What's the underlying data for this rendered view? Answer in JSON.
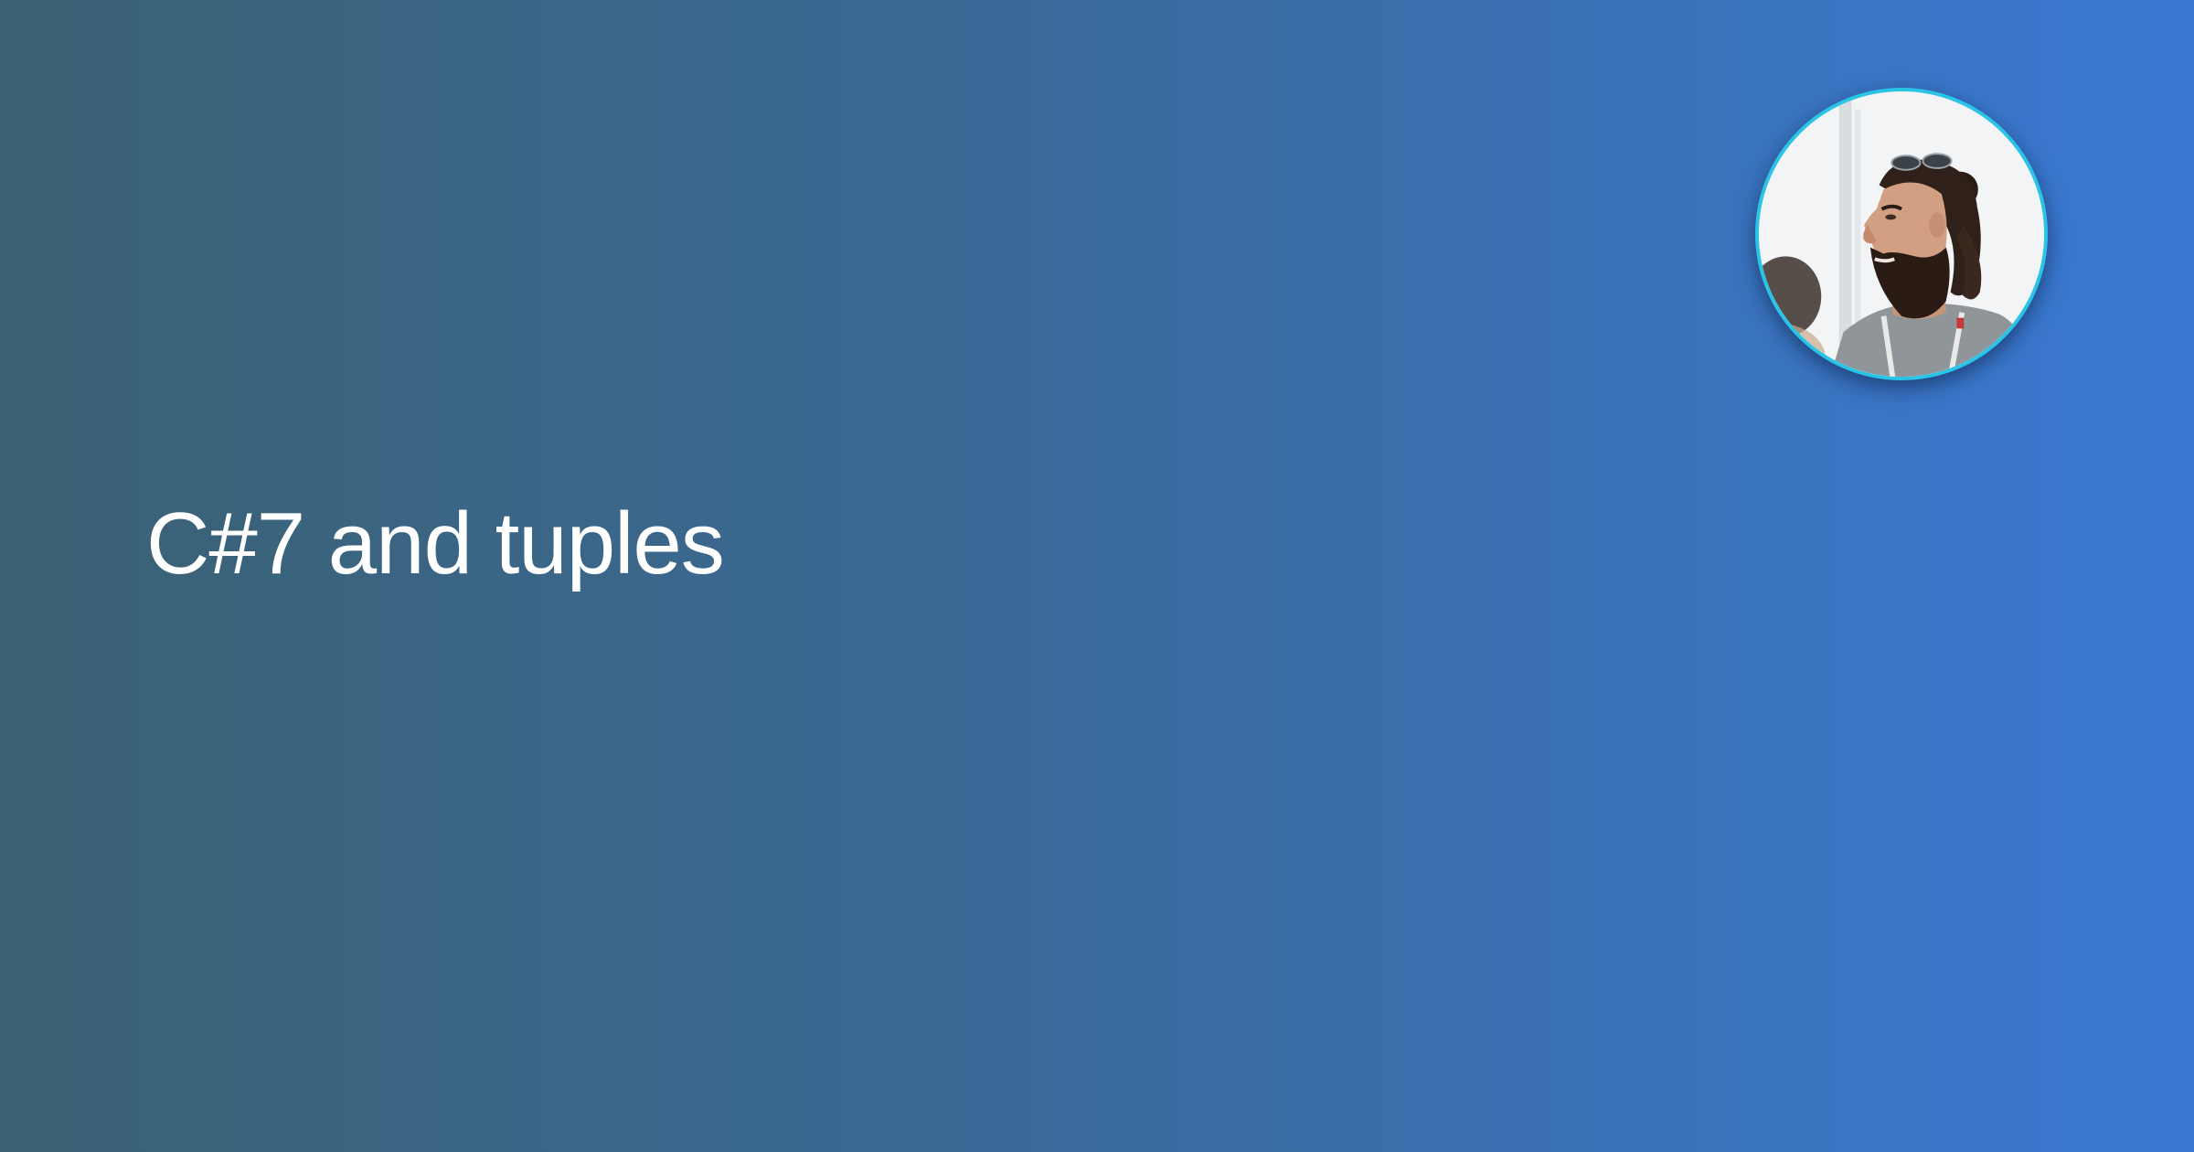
{
  "post": {
    "title": "C#7 and tuples"
  },
  "author": {
    "avatar_description": "avatar",
    "ring_color": "#29c4e6"
  },
  "theme": {
    "gradient_start": "#3a6072",
    "gradient_end": "#3978d3",
    "text_color": "#ffffff"
  }
}
